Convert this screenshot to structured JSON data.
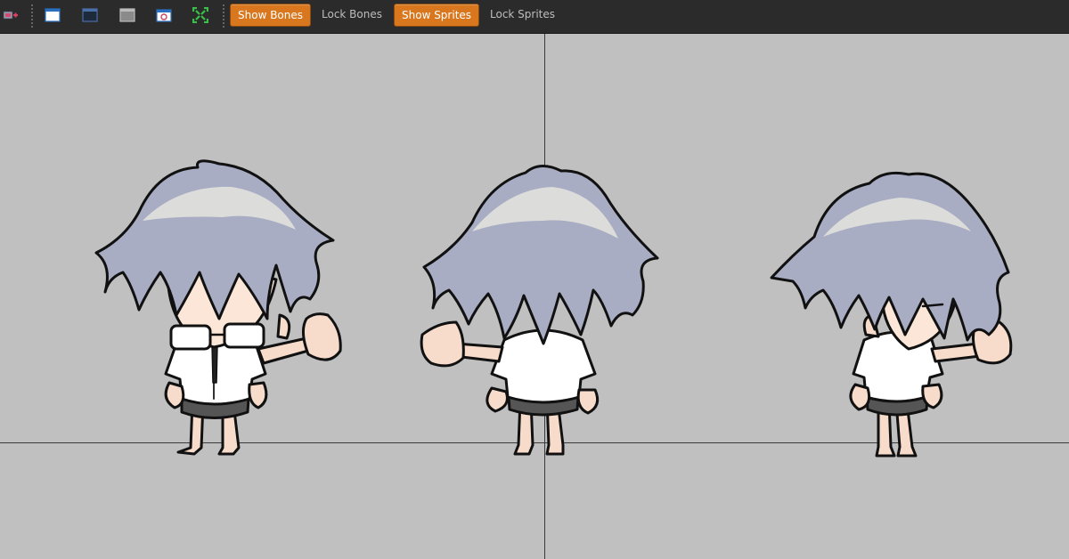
{
  "toolbar": {
    "buttons": [
      {
        "label": "Show Bones",
        "active": true
      },
      {
        "label": "Lock Bones",
        "active": false
      },
      {
        "label": "Show Sprites",
        "active": true
      },
      {
        "label": "Lock Sprites",
        "active": false
      }
    ],
    "icons": [
      "add-track-icon",
      "window-icon",
      "dark-window-icon",
      "gray-window-icon",
      "calendar-icon",
      "fit-view-icon"
    ]
  },
  "colors": {
    "accent": "#d9771e",
    "toolbar_bg": "#2b2b2b",
    "canvas_bg": "#c0c0c0"
  },
  "canvas": {
    "sprites": [
      "character-front",
      "character-back",
      "character-side"
    ]
  }
}
